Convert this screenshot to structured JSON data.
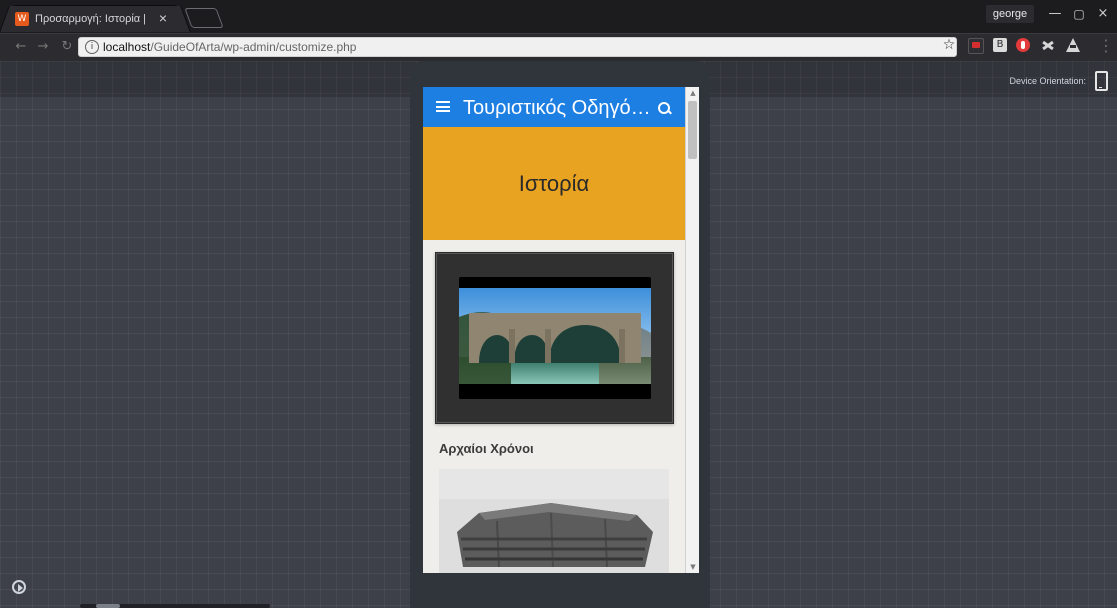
{
  "browser": {
    "tab": {
      "title": "Προσαρμογή: Ιστορία | Τ",
      "favicon_text": "W",
      "close_glyph": "×"
    },
    "profile": {
      "name": "george"
    },
    "window_controls": {
      "min": "—",
      "max": "▢",
      "close": "×"
    },
    "nav": {
      "back": "←",
      "forward": "→",
      "reload": "↻"
    },
    "address": {
      "info_glyph": "i",
      "host": "localhost",
      "path": "/GuideOfArta/wp-admin/customize.php"
    },
    "star_glyph": "☆",
    "extensions": [
      {
        "name": "red-extension-icon"
      },
      {
        "name": "b-extension-icon"
      },
      {
        "name": "opera-extension-icon"
      },
      {
        "name": "tools-extension-icon"
      },
      {
        "name": "drive-extension-icon"
      }
    ],
    "menu_glyph": "⋮"
  },
  "customizer": {
    "device_orientation_label": "Device Orientation:",
    "colors": {
      "workspace_bg": "#3d4048",
      "bezel_bg": "#30343b"
    }
  },
  "site": {
    "header": {
      "title": "Τουριστικός Οδηγό…",
      "color": "#1e7fe3"
    },
    "hero": {
      "title": "Ιστορία",
      "color": "#e8a320"
    },
    "sections": [
      {
        "title": "Αρχαίοι Χρόνοι"
      }
    ],
    "scrollbar": {
      "up_glyph": "▲",
      "down_glyph": "▼"
    }
  }
}
